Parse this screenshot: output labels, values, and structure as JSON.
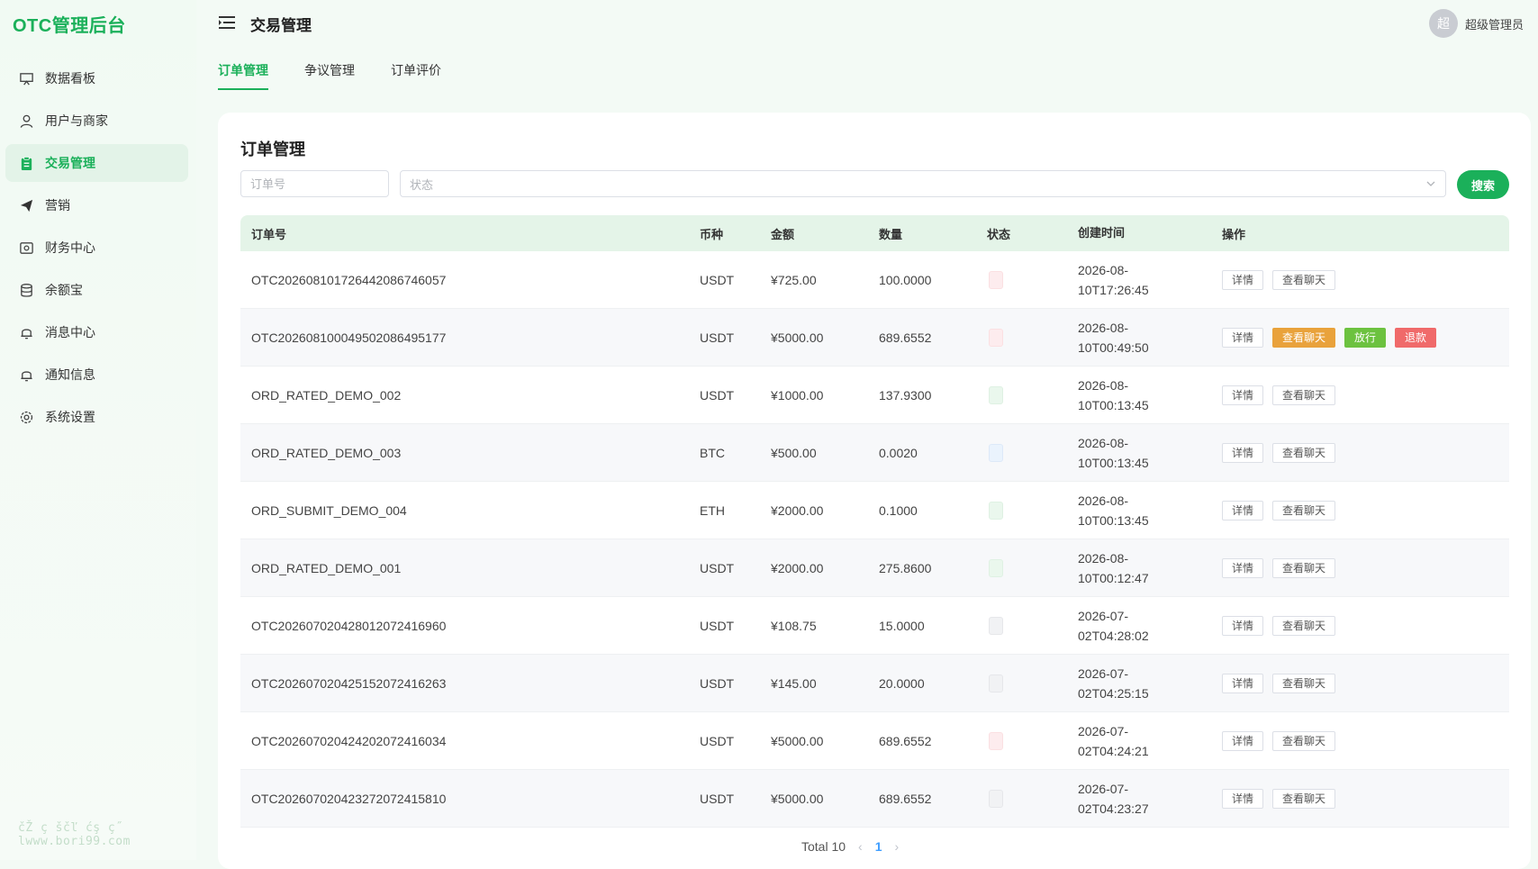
{
  "brand": "OTC管理后台",
  "sidebar": {
    "items": [
      {
        "label": "数据看板",
        "icon": "dashboard-icon",
        "active": false
      },
      {
        "label": "用户与商家",
        "icon": "user-icon",
        "active": false
      },
      {
        "label": "交易管理",
        "icon": "clipboard-icon",
        "active": true
      },
      {
        "label": "营销",
        "icon": "send-icon",
        "active": false
      },
      {
        "label": "财务中心",
        "icon": "finance-icon",
        "active": false
      },
      {
        "label": "余额宝",
        "icon": "database-icon",
        "active": false
      },
      {
        "label": "消息中心",
        "icon": "bell-icon",
        "active": false
      },
      {
        "label": "通知信息",
        "icon": "bell-icon",
        "active": false
      },
      {
        "label": "系统设置",
        "icon": "gear-icon",
        "active": false
      }
    ]
  },
  "watermark": "čŽ ç ščľ ćş ç˝ lwww.bori99.com",
  "header": {
    "title": "交易管理",
    "avatar_text": "超",
    "username": "超级管理员"
  },
  "tabs": [
    {
      "label": "订单管理",
      "active": true
    },
    {
      "label": "争议管理",
      "active": false
    },
    {
      "label": "订单评价",
      "active": false
    }
  ],
  "panel": {
    "title": "订单管理",
    "order_placeholder": "订单号",
    "status_placeholder": "状态",
    "search_label": "搜索"
  },
  "table": {
    "columns": [
      "订单号",
      "币种",
      "金额",
      "数量",
      "状态",
      "创建时间",
      "操作"
    ],
    "rows": [
      {
        "id": "OTC20260810172644208674605 7",
        "coin": "USDT",
        "amount": "¥725.00",
        "qty": "100.0000",
        "status": "red",
        "time1": "2026-08-",
        "time2": "10T17:26:45",
        "ops": [
          "详情",
          "查看聊天"
        ]
      },
      {
        "id": "OTC2026081000495020864951 77",
        "coin": "USDT",
        "amount": "¥5000.00",
        "qty": "689.6552",
        "status": "red",
        "time1": "2026-08-",
        "time2": "10T00:49:50",
        "ops": [
          "详情",
          "查看聊天",
          "放行",
          "退款"
        ]
      },
      {
        "id": "ORD_RATED_DEMO_002",
        "coin": "USDT",
        "amount": "¥1000.00",
        "qty": "137.9300",
        "status": "green",
        "time1": "2026-08-",
        "time2": "10T00:13:45",
        "ops": [
          "详情",
          "查看聊天"
        ]
      },
      {
        "id": "ORD_RATED_DEMO_003",
        "coin": "BTC",
        "amount": "¥500.00",
        "qty": "0.0020",
        "status": "blue",
        "time1": "2026-08-",
        "time2": "10T00:13:45",
        "ops": [
          "详情",
          "查看聊天"
        ]
      },
      {
        "id": "ORD_SUBMIT_DEMO_004",
        "coin": "ETH",
        "amount": "¥2000.00",
        "qty": "0.1000",
        "status": "green",
        "time1": "2026-08-",
        "time2": "10T00:13:45",
        "ops": [
          "详情",
          "查看聊天"
        ]
      },
      {
        "id": "ORD_RATED_DEMO_001",
        "coin": "USDT",
        "amount": "¥2000.00",
        "qty": "275.8600",
        "status": "green",
        "time1": "2026-08-",
        "time2": "10T00:12:47",
        "ops": [
          "详情",
          "查看聊天"
        ]
      },
      {
        "id": "OTC2026070204280120724169 60",
        "coin": "USDT",
        "amount": "¥108.75",
        "qty": "15.0000",
        "status": "gray",
        "time1": "2026-07-",
        "time2": "02T04:28:02",
        "ops": [
          "详情",
          "查看聊天"
        ]
      },
      {
        "id": "OTC2026070204251520724162 63",
        "coin": "USDT",
        "amount": "¥145.00",
        "qty": "20.0000",
        "status": "gray",
        "time1": "2026-07-",
        "time2": "02T04:25:15",
        "ops": [
          "详情",
          "查看聊天"
        ]
      },
      {
        "id": "OTC2026070204242020724160 34",
        "coin": "USDT",
        "amount": "¥5000.00",
        "qty": "689.6552",
        "status": "red",
        "time1": "2026-07-",
        "time2": "02T04:24:21",
        "ops": [
          "详情",
          "查看聊天"
        ]
      },
      {
        "id": "OTC2026070204232720724158 10",
        "coin": "USDT",
        "amount": "¥5000.00",
        "qty": "689.6552",
        "status": "gray",
        "time1": "2026-07-",
        "time2": "02T04:23:27",
        "ops": [
          "详情",
          "查看聊天"
        ]
      }
    ]
  },
  "pagination": {
    "total": "Total 10",
    "current": "1",
    "prev_icon": "chevron-left-icon",
    "next_icon": "chevron-right-icon"
  }
}
